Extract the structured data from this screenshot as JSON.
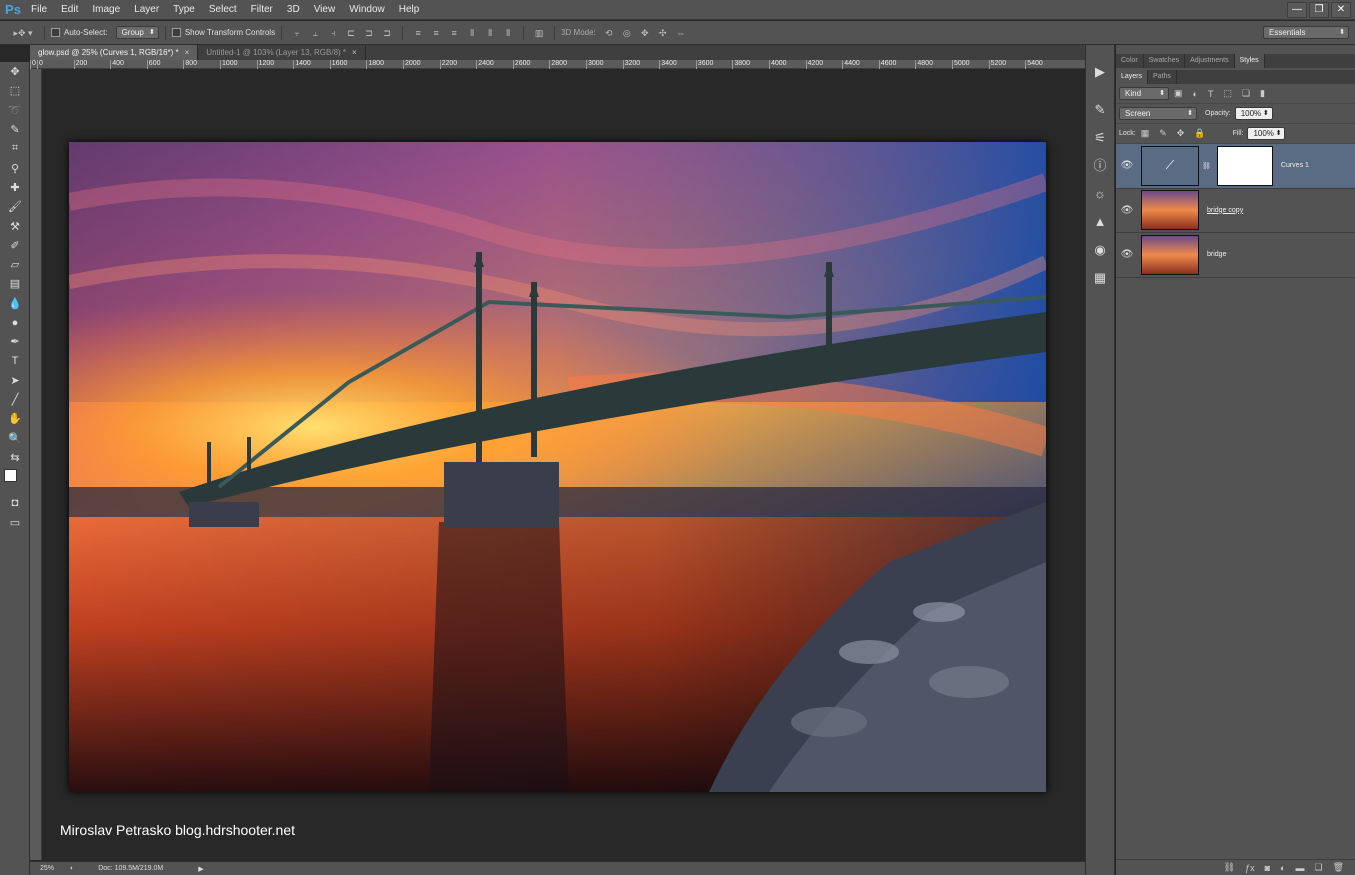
{
  "app": {
    "logo": "Ps"
  },
  "menu": [
    "File",
    "Edit",
    "Image",
    "Layer",
    "Type",
    "Select",
    "Filter",
    "3D",
    "View",
    "Window",
    "Help"
  ],
  "window_controls": [
    "—",
    "❐",
    "✕"
  ],
  "options": {
    "auto_select_label": "Auto-Select:",
    "auto_select_value": "Group",
    "transform_label": "Show Transform Controls",
    "mode3d_label": "3D Mode:",
    "workspace": "Essentials"
  },
  "tabs": [
    {
      "label": "glow.psd @ 25% (Curves 1, RGB/16*) *",
      "close": "×"
    },
    {
      "label": "Untitled-1 @ 103% (Layer 13, RGB/8) *",
      "close": "×"
    }
  ],
  "ruler": [
    "0",
    "0",
    "200",
    "400",
    "600",
    "800",
    "1000",
    "1200",
    "1400",
    "1600",
    "1800",
    "2000",
    "2200",
    "2400",
    "2600",
    "2800",
    "3000",
    "3200",
    "3400",
    "3600",
    "3800",
    "4000",
    "4200",
    "4400",
    "4600",
    "4800",
    "5000",
    "5200",
    "5400"
  ],
  "watermark": "Miroslav  Petrasko  blog.hdrshooter.net",
  "status": {
    "zoom": "25%",
    "doc": "Doc: 109.5M/219.0M"
  },
  "panels": {
    "top_tabs": [
      "Color",
      "Swatches",
      "Adjustments",
      "Styles"
    ],
    "layer_tabs": [
      "Layers",
      "Paths"
    ],
    "filter_kind": "Kind",
    "blend_mode": "Screen",
    "opacity_label": "Opacity:",
    "opacity_value": "100%",
    "lock_label": "Lock:",
    "fill_label": "Fill:",
    "fill_value": "100%",
    "layers": [
      {
        "name": "Curves 1",
        "selected": true,
        "type": "adjustment"
      },
      {
        "name": "bridge copy",
        "selected": false,
        "type": "image"
      },
      {
        "name": "bridge",
        "selected": false,
        "type": "image"
      }
    ]
  },
  "colors": {
    "accent": "#4aa3df",
    "selected_layer": "#5a6b84",
    "panel_bg": "#535353",
    "canvas_bg": "#282828"
  }
}
